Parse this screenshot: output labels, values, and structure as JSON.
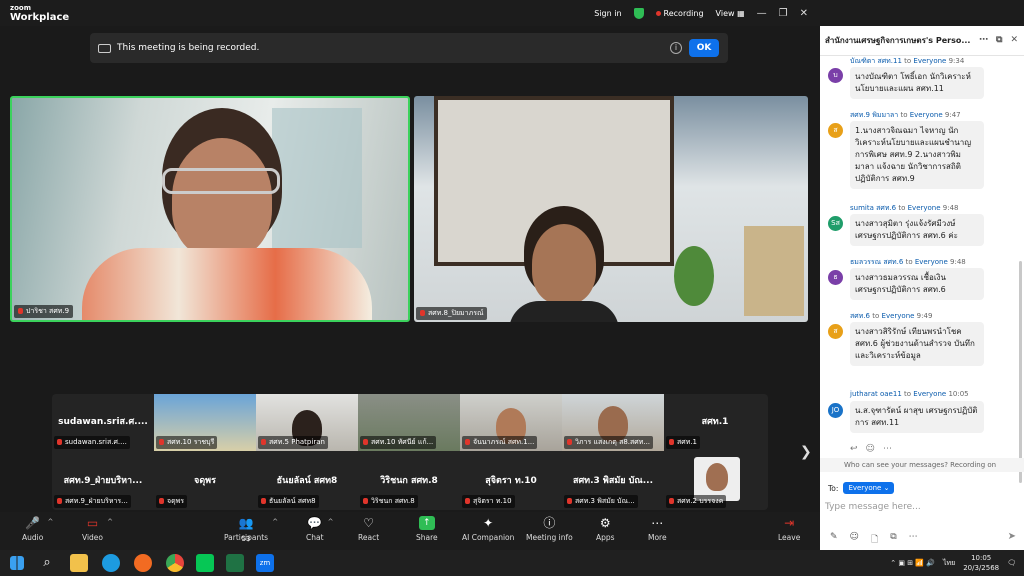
{
  "app": {
    "logo_top": "zoom",
    "logo_bottom": "Workplace"
  },
  "titlebar": {
    "sign_in": "Sign in",
    "recording": "Recording",
    "view": "View"
  },
  "banner": {
    "text": "This meeting is being recorded.",
    "ok": "OK",
    "info": "i"
  },
  "videos": [
    {
      "label": "ปาริชา สศท.9"
    },
    {
      "label": "สศท.8_ปิยมาภรณ์"
    }
  ],
  "gallery": {
    "row1": [
      {
        "name": "sudawan.sriส.ศ....",
        "label": "sudawan.sriส.ศ...."
      },
      {
        "name": "",
        "label": "สศท.10 ราชบุรี"
      },
      {
        "name": "",
        "label": "สศท.5 Phatpiran"
      },
      {
        "name": "",
        "label": "สศท.10 ทัศนีย์ แก้..."
      },
      {
        "name": "",
        "label": "จันนาภรณ์ สศท.1..."
      },
      {
        "name": "",
        "label": "วิภาร แสงเกตุ ส8.สศท..."
      },
      {
        "name": "สศท.1",
        "label": "สศท.1"
      }
    ],
    "row2": [
      {
        "name": "สศท.9_ฝ่ายบริหา...",
        "label": "สศท.9_ฝ่ายบริหาร..."
      },
      {
        "name": "จดุพร",
        "label": "จดุพร"
      },
      {
        "name": "ธันยลัลน์ สศท8",
        "label": "ธันยลัลน์ สศท8"
      },
      {
        "name": "วิริชนก สศท.8",
        "label": "วิริชนก สศท.8"
      },
      {
        "name": "สุจิตรา ท.10",
        "label": "สุจิตรา ท.10"
      },
      {
        "name": "สศท.3 พิสมัย บัณ...",
        "label": "สศท.3 พิสมัย บัณ..."
      },
      {
        "name": "",
        "label": "สศท.2 บรรจงค"
      }
    ]
  },
  "toolbar": {
    "audio": "Audio",
    "video": "Video",
    "participants": "Participants",
    "participants_count": "53",
    "chat": "Chat",
    "react": "React",
    "share": "Share",
    "ai": "AI Companion",
    "meeting_info": "Meeting info",
    "apps": "Apps",
    "more": "More",
    "leave": "Leave"
  },
  "chat": {
    "title": "สำนักงานเศรษฐกิจการเกษตร's Perso...",
    "messages": [
      {
        "sender": "บัณฑิตา สศท.11",
        "to": "to",
        "recipient": "Everyone",
        "time": "9:34",
        "avatar": "บ",
        "color": "#7a3fa8",
        "text": "นางบัณฑิตา โพธิ์เอก นักวิเคราะห์นโยบายและแผน สศท.11"
      },
      {
        "sender": "สศท.9 พิมมาลา",
        "to": "to",
        "recipient": "Everyone",
        "time": "9:47",
        "avatar": "ส",
        "color": "#e8a019",
        "text": "1.นางสาวจิณฉมา ไจหาญ นักวิเคราะห์นโยบายและแผนชำนาญการพิเศษ สศท.9 2.นางสาวพิมมาลา แจ้งฉาย นักวิชาการสถิติปฏิบัติการ สศท.9"
      },
      {
        "sender": "sumita สศท.6",
        "to": "to",
        "recipient": "Everyone",
        "time": "9:48",
        "avatar": "Sส",
        "color": "#1f9d6a",
        "text": "นางสาวสุมิตา รุ่งแจ้งรัศมีวงษ์ เศรษฐกรปฏิบัติการ สศท.6 ค่ะ"
      },
      {
        "sender": "ธมลวรรณ สศท.6",
        "to": "to",
        "recipient": "Everyone",
        "time": "9:48",
        "avatar": "ธ",
        "color": "#7a3fa8",
        "text": "นางสาวธมลวรรณ เชื้อเงิน เศรษฐกรปฏิบัติการ สศท.6"
      },
      {
        "sender": "สศท.6",
        "to": "to",
        "recipient": "Everyone",
        "time": "9:49",
        "avatar": "ส",
        "color": "#e8a019",
        "text": "นางสาวสิริรักษ์ เทียนพรนำโชค สศท.6 ผู้ช่วยงานด้านสำรวจ บันทึกและวิเคราะห์ข้อมูล"
      },
      {
        "sender": "jutharat oae11",
        "to": "to",
        "recipient": "Everyone",
        "time": "10:05",
        "avatar": "JO",
        "color": "#1a73c8",
        "text": "น.ส.จุฑารัตน์ ผาสุข เศรษฐกรปฏิบัติการ สศท.11"
      }
    ],
    "who_can_see": "Who can see your messages? Recording on",
    "to_label": "To:",
    "to_value": "Everyone",
    "input_placeholder": "Type message here..."
  },
  "taskbar": {
    "time": "10:05",
    "date": "20/3/2568",
    "lang": "ไทย",
    "zoom_label": "zm"
  }
}
